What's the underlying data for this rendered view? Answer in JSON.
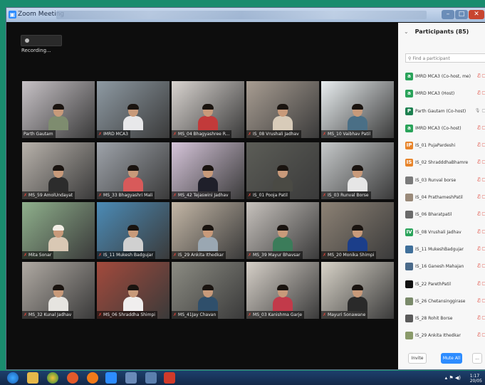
{
  "window": {
    "title": "Zoom Meeting"
  },
  "recording": {
    "label": "Recording..."
  },
  "tiles": [
    {
      "name": "Parth Gautam",
      "muted": false,
      "bg": "#c7c2c6",
      "shirt": "#7e8c6f",
      "hair": "#1a1410"
    },
    {
      "name": "IMRD MCA3",
      "muted": true,
      "bg": "#8e9aa3",
      "shirt": "#e8e8ea",
      "hair": "#1a1410"
    },
    {
      "name": "MS_04 Bhagyashree R...",
      "muted": true,
      "bg": "#d9d4d0",
      "shirt": "#c23a3a",
      "hair": "#1a1410"
    },
    {
      "name": "IS_08 Vrushali Jadhav",
      "muted": true,
      "bg": "#a89d92",
      "shirt": "#d8cbb9",
      "hair": "#1a1410"
    },
    {
      "name": "MS_10 Vaibhav Patil",
      "muted": true,
      "bg": "#e9eef0",
      "shirt": "#4a6f86",
      "hair": "#1a1410"
    },
    {
      "name": "MS_59 AmolUndayat",
      "muted": true,
      "bg": "#b8b2ab",
      "shirt": "#2c2c2c",
      "hair": "#1a1410"
    },
    {
      "name": "MS_33 Bhagyashri Mali",
      "muted": true,
      "bg": "#9ea3aa",
      "shirt": "#d85a5a",
      "hair": "#1a1410"
    },
    {
      "name": "MS_42 Tejaswini Jadhav",
      "muted": true,
      "bg": "#d6c5da",
      "shirt": "#1f1f2a",
      "hair": "#1a1410"
    },
    {
      "name": "IS_01 Pooja Patil",
      "muted": true,
      "bg": "#5c5d57",
      "shirt": "#4a4a44",
      "hair": "#1a1410"
    },
    {
      "name": "IS_03 Runval Borse",
      "muted": true,
      "bg": "#c6c9ca",
      "shirt": "#e6e6e6",
      "hair": "#1a1410"
    },
    {
      "name": "Mita Sonar",
      "muted": true,
      "bg": "#8fb08c",
      "shirt": "#d9c8b4",
      "hair": "#f3eee6"
    },
    {
      "name": "IS_11 Mukesh Badgujar",
      "muted": true,
      "bg": "#4b8bb6",
      "shirt": "#d0d0d0",
      "hair": "#1a1410"
    },
    {
      "name": "IS_29 Ankita Ithedkar",
      "muted": true,
      "bg": "#c4b7a6",
      "shirt": "#9aa7b2",
      "hair": "#1a1410"
    },
    {
      "name": "MS_39 Mayur Bhavsar",
      "muted": true,
      "bg": "#c7c2bd",
      "shirt": "#3b7c5a",
      "hair": "#1a1410"
    },
    {
      "name": "MS_20 Monika Shimpi",
      "muted": true,
      "bg": "#8d8275",
      "shirt": "#1b3e8a",
      "hair": "#1a1410"
    },
    {
      "name": "MS_32 Kunal Jadhav",
      "muted": true,
      "bg": "#b0aaa3",
      "shirt": "#e6e4e0",
      "hair": "#1a1410"
    },
    {
      "name": "MS_06 Shraddha Shimpi",
      "muted": true,
      "bg": "#a34a3c",
      "shirt": "#f0eeee",
      "hair": "#1a1410"
    },
    {
      "name": "MS_41Jay Chavan",
      "muted": true,
      "bg": "#8c8c83",
      "shirt": "#2f4f6b",
      "hair": "#1a1410"
    },
    {
      "name": "MS_03 Kanishma Garje",
      "muted": true,
      "bg": "#d6d0c8",
      "shirt": "#c23a4a",
      "hair": "#1a1410"
    },
    {
      "name": "Mayuri Sonawane",
      "muted": true,
      "bg": "#d8d3c8",
      "shirt": "#2a2a2a",
      "hair": "#1a1410"
    }
  ],
  "participants": {
    "title": "Participants (85)",
    "search_placeholder": "Find a participant",
    "list": [
      {
        "name": "IMRD MCA3 (Co-host, me)",
        "avatar": "a",
        "color": "#2aa35a",
        "muted": true
      },
      {
        "name": "IMRD MCA3 (Host)",
        "avatar": "a",
        "color": "#2aa35a",
        "muted": true
      },
      {
        "name": "Parth Gautam (Co-host)",
        "avatar": "P",
        "color": "#1d8050",
        "muted": false
      },
      {
        "name": "IMRD MCA3 (Co-host)",
        "avatar": "a",
        "color": "#2aa35a",
        "muted": true
      },
      {
        "name": "IS_01 PujaPardeshi",
        "avatar": "IP",
        "color": "#e8842a",
        "muted": true
      },
      {
        "name": "IS_02 ShradddhaBhamre",
        "avatar": "IS",
        "color": "#e8842a",
        "muted": true
      },
      {
        "name": "IS_03 Runval borse",
        "avatar": "",
        "color": "#7a7a7a",
        "muted": true
      },
      {
        "name": "IS_04 PrathameshPatil",
        "avatar": "",
        "color": "#9a8a7a",
        "muted": true
      },
      {
        "name": "IS_06 Bharatpatil",
        "avatar": "",
        "color": "#6a6a6a",
        "muted": true
      },
      {
        "name": "IS_08 Vrushali Jadhav",
        "avatar": "IV",
        "color": "#2aa35a",
        "muted": true
      },
      {
        "name": "IS_11 MukeshBadgujar",
        "avatar": "",
        "color": "#3f6f9a",
        "muted": true
      },
      {
        "name": "IS_16 Ganesh Mahajan",
        "avatar": "",
        "color": "#4a6a8a",
        "muted": true
      },
      {
        "name": "IS_22 ParethPatil",
        "avatar": "",
        "color": "#111111",
        "muted": true
      },
      {
        "name": "IS_26 Chetansinggirase",
        "avatar": "",
        "color": "#7a8a6a",
        "muted": true
      },
      {
        "name": "IS_28 Rohit Borse",
        "avatar": "",
        "color": "#5a5a5a",
        "muted": true
      },
      {
        "name": "IS_29 Ankita Ithedkar",
        "avatar": "",
        "color": "#8a9a6a",
        "muted": true
      }
    ],
    "invite_label": "Invite",
    "muteall_label": "Mute All",
    "more_label": "..."
  },
  "taskbar": {
    "clock_time": "1:17",
    "clock_date": "20/05"
  }
}
